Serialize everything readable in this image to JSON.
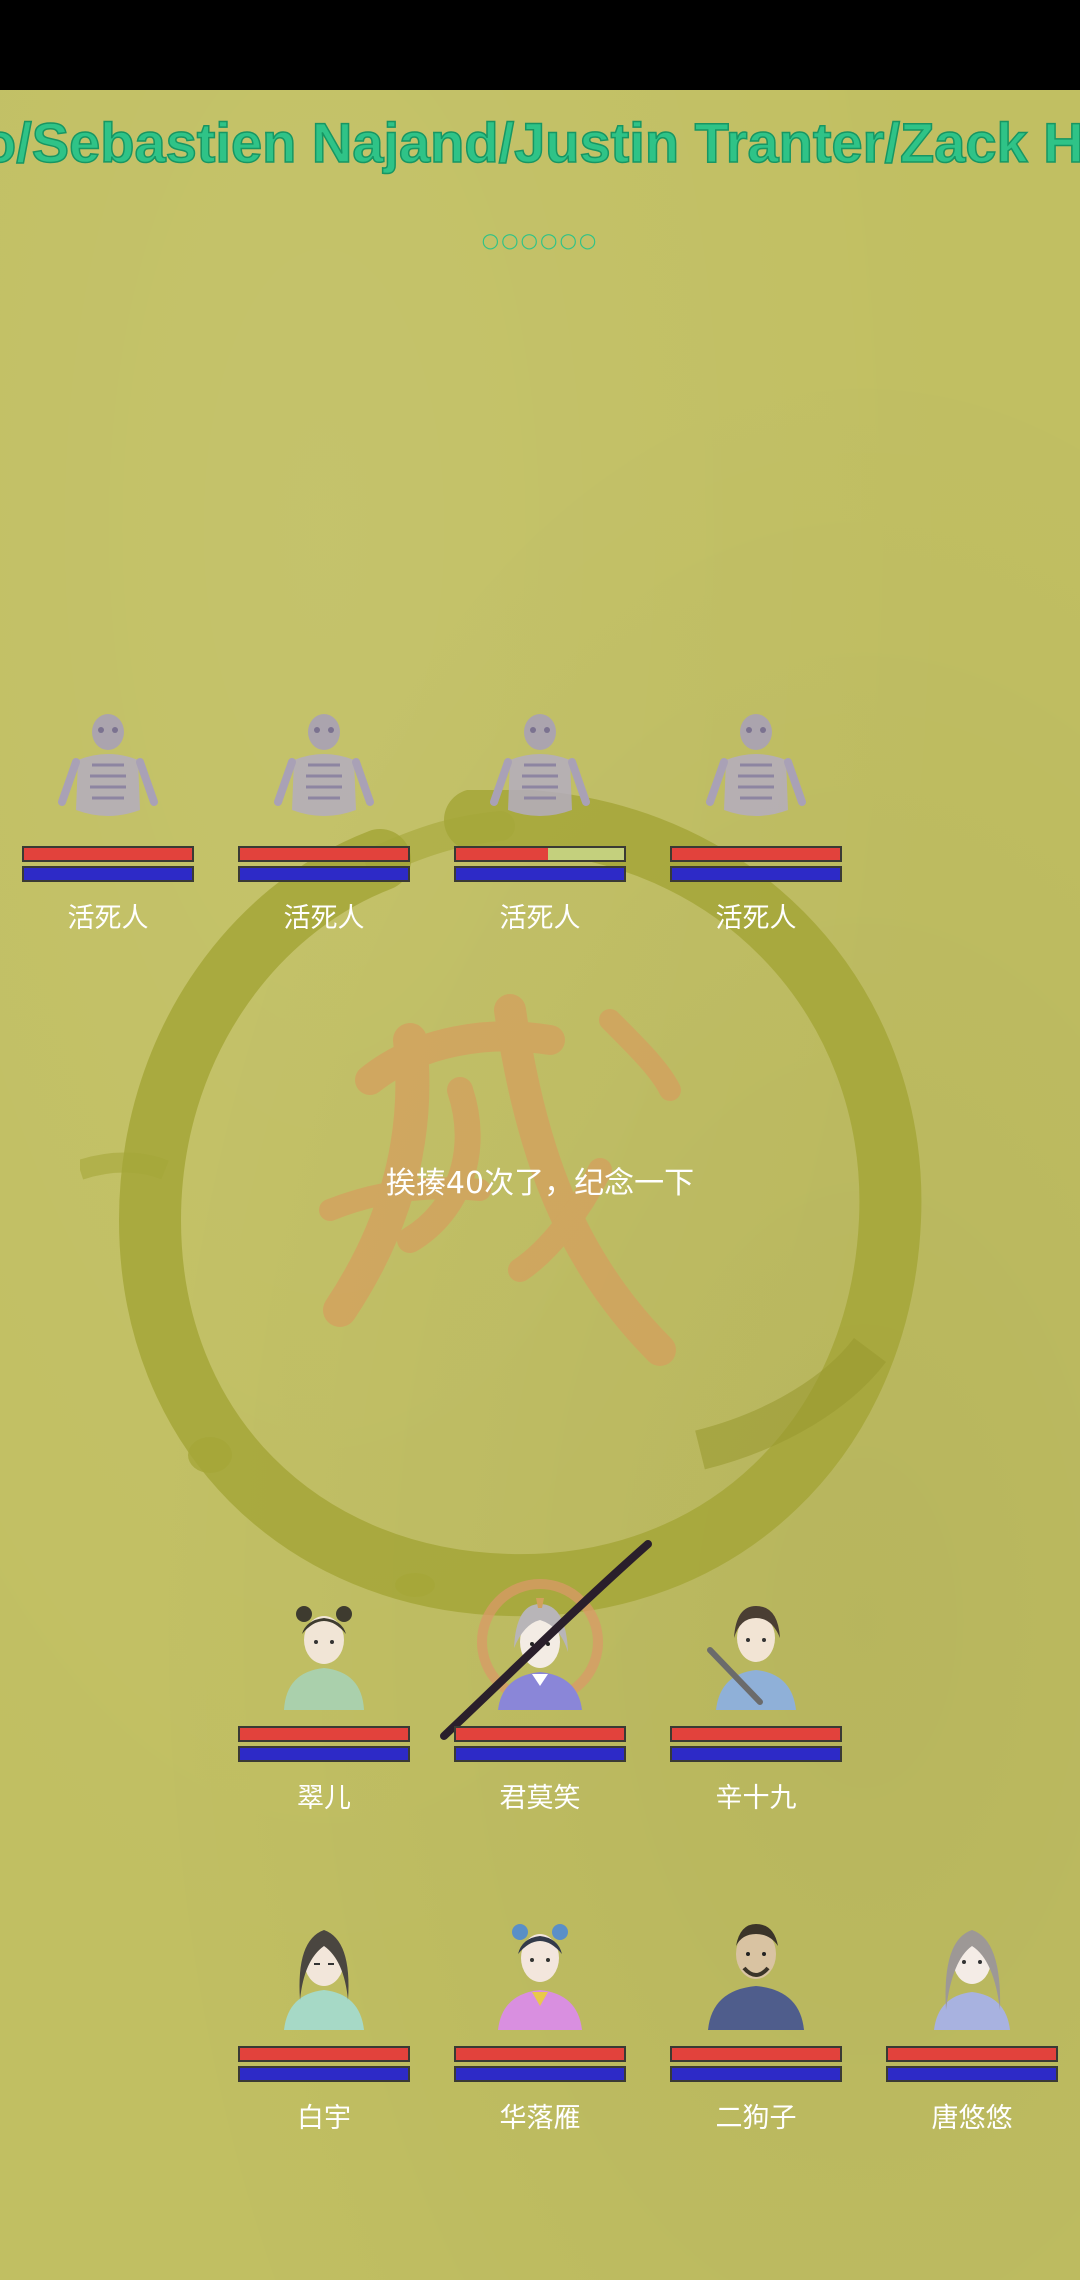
{
  "marquee": {
    "text": "o/Sebastien Najand/Justin Tranter/Zack Ha"
  },
  "indicator": {
    "text": "○○○○○○"
  },
  "message": "挨揍40次了，纪念一下",
  "colors": {
    "background": "#c1bf62",
    "hp": "#e2423c",
    "mp": "#2d2ac7",
    "marquee": "#2fc387"
  },
  "enemies": [
    {
      "name": "活死人",
      "portrait_icon": "skeleton-icon",
      "hp": 1.0,
      "mp": 1.0
    },
    {
      "name": "活死人",
      "portrait_icon": "skeleton-icon",
      "hp": 1.0,
      "mp": 1.0
    },
    {
      "name": "活死人",
      "portrait_icon": "skeleton-icon",
      "hp": 0.55,
      "mp": 1.0
    },
    {
      "name": "活死人",
      "portrait_icon": "skeleton-icon",
      "hp": 1.0,
      "mp": 1.0
    }
  ],
  "party_front": [
    {
      "name": "翠儿",
      "portrait_icon": "girl-buns-icon",
      "hp": 1.0,
      "mp": 1.0
    },
    {
      "name": "君莫笑",
      "portrait_icon": "swordsman-icon",
      "hp": 1.0,
      "mp": 1.0,
      "effect": "slash-effect"
    },
    {
      "name": "辛十九",
      "portrait_icon": "staff-youth-icon",
      "hp": 1.0,
      "mp": 1.0
    }
  ],
  "party_back": [
    {
      "name": "白宇",
      "portrait_icon": "long-hair-man-icon",
      "hp": 1.0,
      "mp": 1.0
    },
    {
      "name": "华落雁",
      "portrait_icon": "pink-robe-girl-icon",
      "hp": 1.0,
      "mp": 1.0
    },
    {
      "name": "二狗子",
      "portrait_icon": "bearded-man-icon",
      "hp": 1.0,
      "mp": 1.0
    },
    {
      "name": "唐悠悠",
      "portrait_icon": "gray-hair-woman-icon",
      "hp": 1.0,
      "mp": 1.0
    }
  ]
}
